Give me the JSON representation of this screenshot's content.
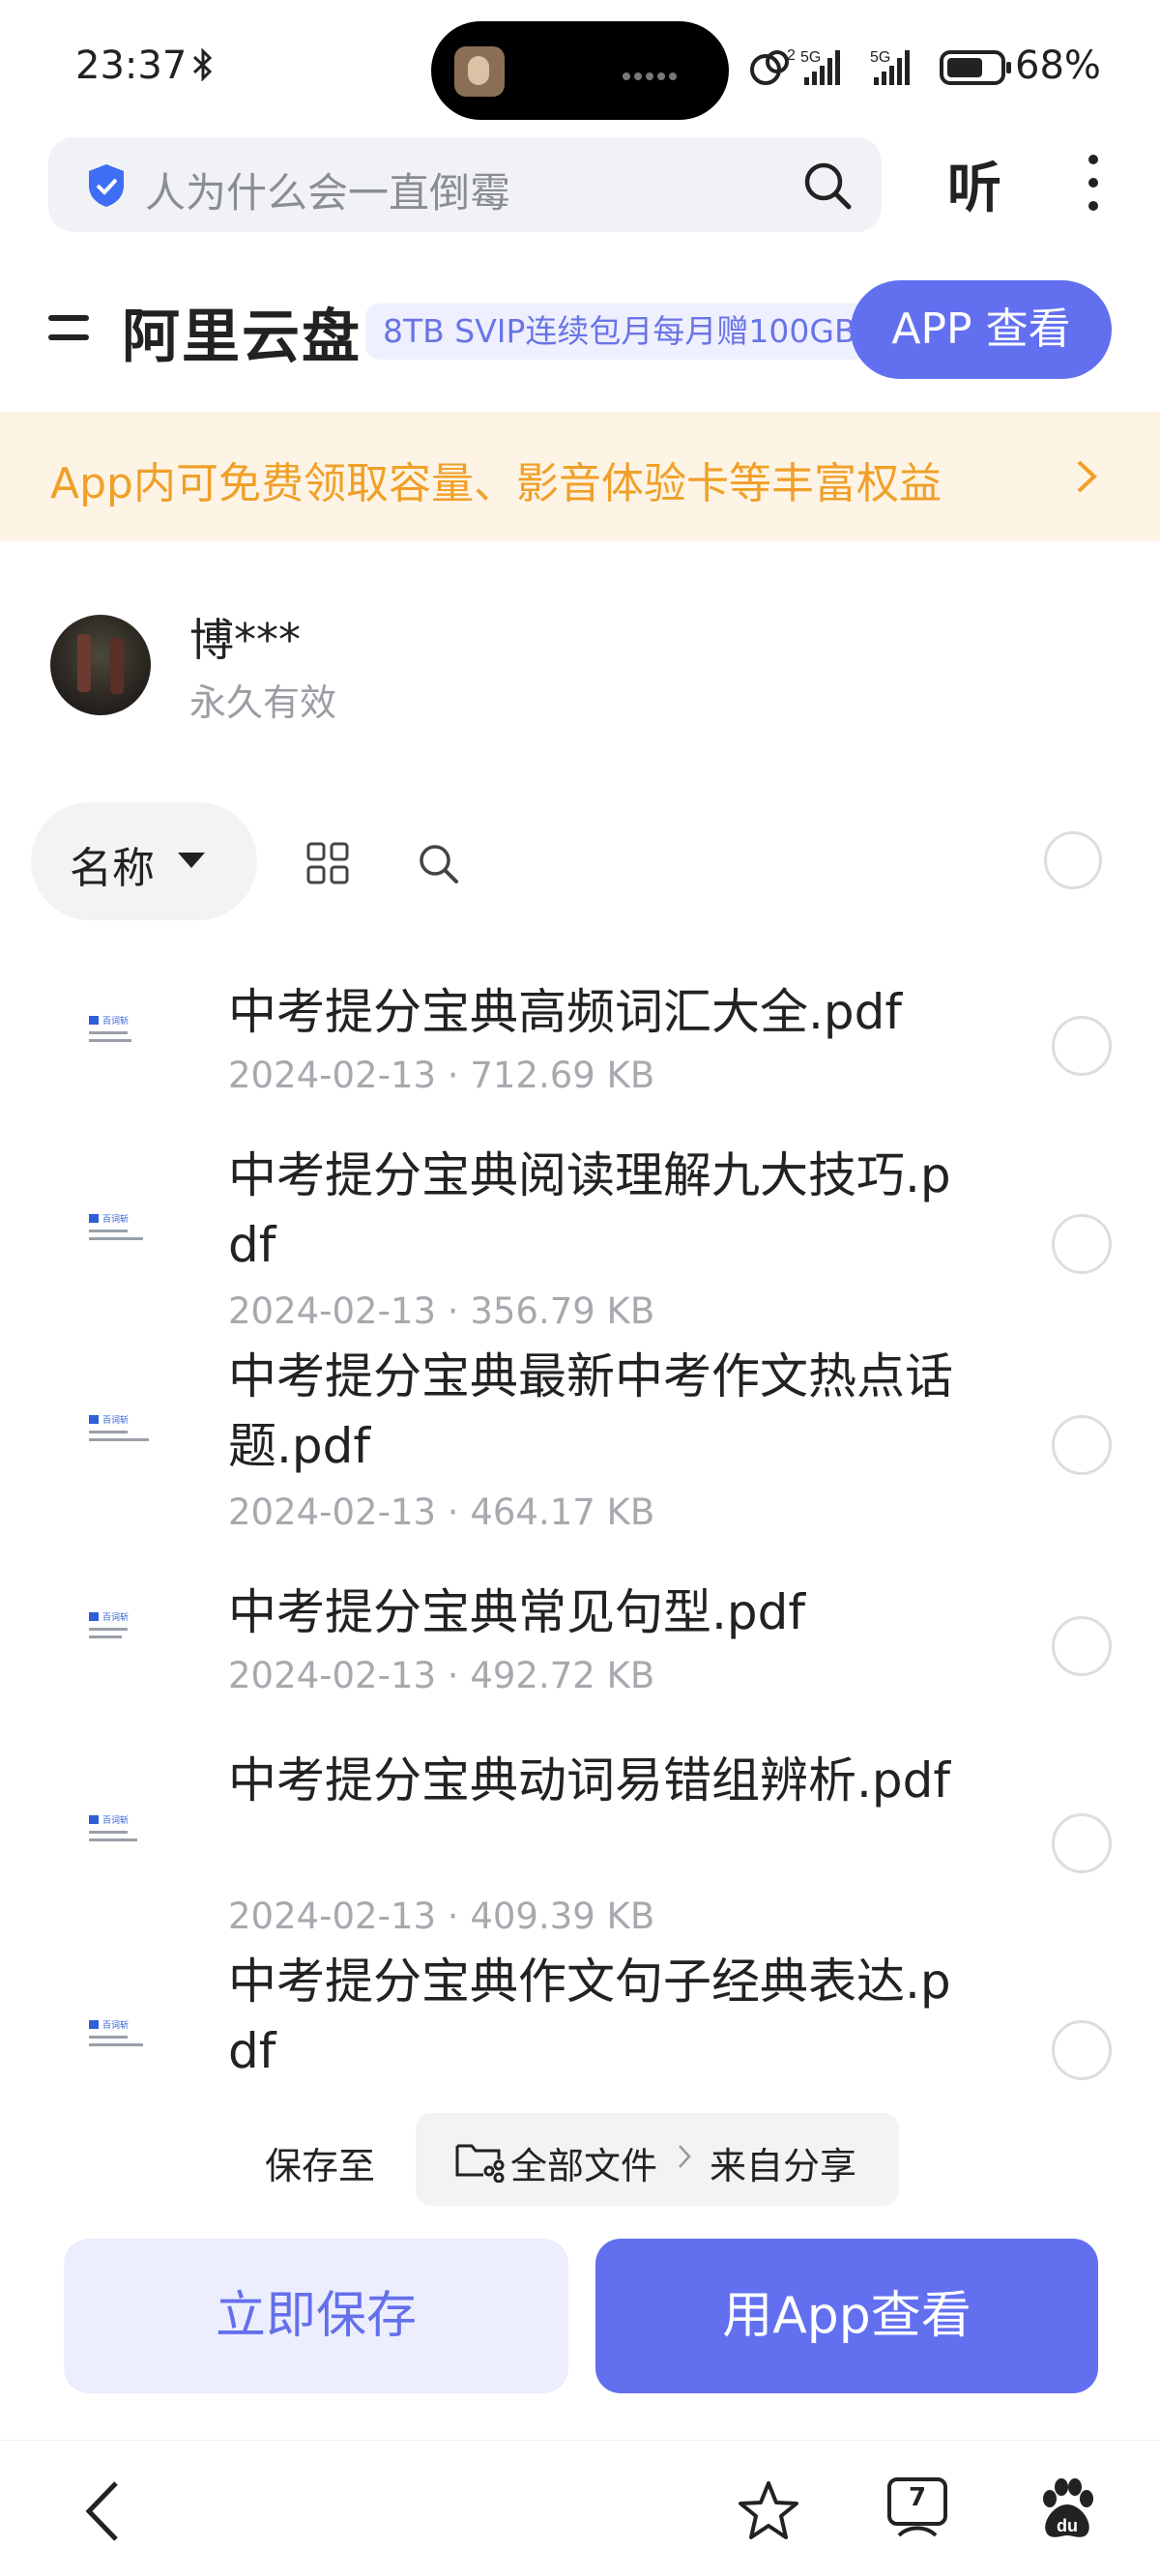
{
  "status_bar": {
    "time": "23:37",
    "battery": "68%",
    "icons": [
      "bluetooth-icon",
      "hotspot-icon",
      "signal-5g-icon",
      "signal-5g-icon",
      "battery-icon"
    ]
  },
  "search": {
    "placeholder": "人为什么会一直倒霉",
    "listen_label": "听"
  },
  "header": {
    "brand": "阿里云盘",
    "promo": "8TB SVIP连续包月每月赠100GB",
    "app_view_button": "APP 查看"
  },
  "banner": {
    "text": "App内可免费领取容量、影音体验卡等丰富权益"
  },
  "share_owner": {
    "name": "博***",
    "validity": "永久有效"
  },
  "toolbar": {
    "sort_label": "名称"
  },
  "files": [
    {
      "name": "中考提分宝典高频词汇大全.pdf",
      "date": "2024-02-13",
      "size": "712.69 KB",
      "thumb_brand": "百词斩"
    },
    {
      "name": "中考提分宝典阅读理解九大技巧.pdf",
      "date": "2024-02-13",
      "size": "356.79 KB",
      "thumb_brand": "百词斩"
    },
    {
      "name": "中考提分宝典最新中考作文热点话题.pdf",
      "date": "2024-02-13",
      "size": "464.17 KB",
      "thumb_brand": "百词斩"
    },
    {
      "name": "中考提分宝典常见句型.pdf",
      "date": "2024-02-13",
      "size": "492.72 KB",
      "thumb_brand": "百词斩"
    },
    {
      "name": "中考提分宝典动词易错组辨析.pdf",
      "date": "2024-02-13",
      "size": "409.39 KB",
      "thumb_brand": "百词斩"
    },
    {
      "name": "中考提分宝典作文句子经典表达.pdf",
      "date": "",
      "size": "",
      "thumb_brand": "百词斩"
    }
  ],
  "save_bar": {
    "label": "保存至",
    "path_root": "全部文件",
    "path_leaf": "来自分享",
    "save_now": "立即保存",
    "open_in_app": "用App查看"
  },
  "bottom_nav": {
    "tab_count": "7"
  },
  "colors": {
    "accent": "#6270f0",
    "banner_text": "#f0a028",
    "banner_bg": "#fdf4e6"
  }
}
